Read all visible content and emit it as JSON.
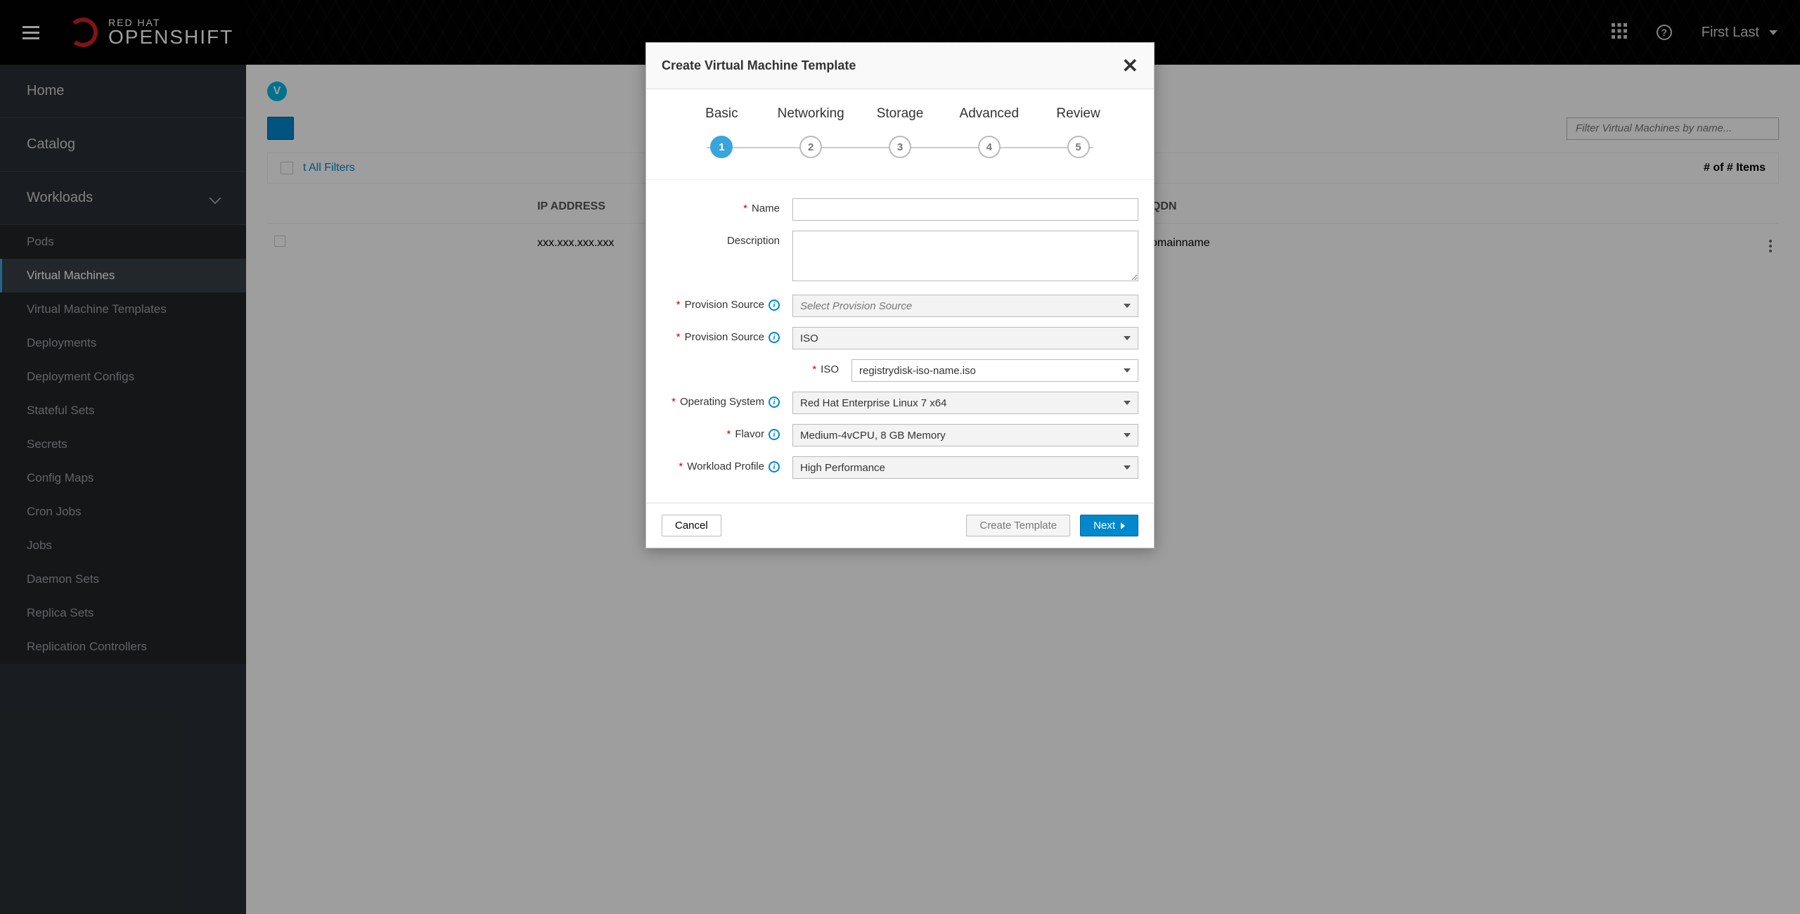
{
  "header": {
    "brand_top": "RED HAT",
    "brand_bottom": "OPENSHIFT",
    "user_name": "First Last"
  },
  "sidebar": {
    "primary": [
      {
        "label": "Home"
      },
      {
        "label": "Catalog"
      },
      {
        "label": "Workloads",
        "expandable": true
      }
    ],
    "secondary": [
      {
        "label": "Pods"
      },
      {
        "label": "Virtual Machines",
        "active": true
      },
      {
        "label": "Virtual Machine Templates"
      },
      {
        "label": "Deployments"
      },
      {
        "label": "Deployment Configs"
      },
      {
        "label": "Stateful Sets"
      },
      {
        "label": "Secrets"
      },
      {
        "label": "Config Maps"
      },
      {
        "label": "Cron Jobs"
      },
      {
        "label": "Jobs"
      },
      {
        "label": "Daemon Sets"
      },
      {
        "label": "Replica Sets"
      },
      {
        "label": "Replication Controllers"
      }
    ]
  },
  "page": {
    "filter_placeholder": "Filter Virtual Machines by name...",
    "reset_filters": "t All Filters",
    "item_count": "# of # Items",
    "columns": {
      "ip": "IP ADDRESS",
      "fqdn": "FQDN"
    },
    "row": {
      "ip": "xxx.xxx.xxx.xxx",
      "fqdn": "domainname"
    }
  },
  "wizard": {
    "title": "Create Virtual Machine Template",
    "steps": [
      "Basic",
      "Networking",
      "Storage",
      "Advanced",
      "Review"
    ],
    "active_step": 1,
    "fields": {
      "name_label": "Name",
      "name_value": "",
      "description_label": "Description",
      "description_value": "",
      "provision_source_label": "Provision Source",
      "provision_source_placeholder": "Select Provision Source",
      "provision_source_value": "ISO",
      "iso_label": "ISO",
      "iso_value": "registrydisk-iso-name.iso",
      "os_label": "Operating System",
      "os_value": "Red Hat Enterprise Linux 7 x64",
      "flavor_label": "Flavor",
      "flavor_value": "Medium-4vCPU, 8 GB Memory",
      "workload_label": "Workload Profile",
      "workload_value": "High Performance"
    },
    "buttons": {
      "cancel": "Cancel",
      "create_template": "Create Template",
      "next": "Next"
    }
  }
}
